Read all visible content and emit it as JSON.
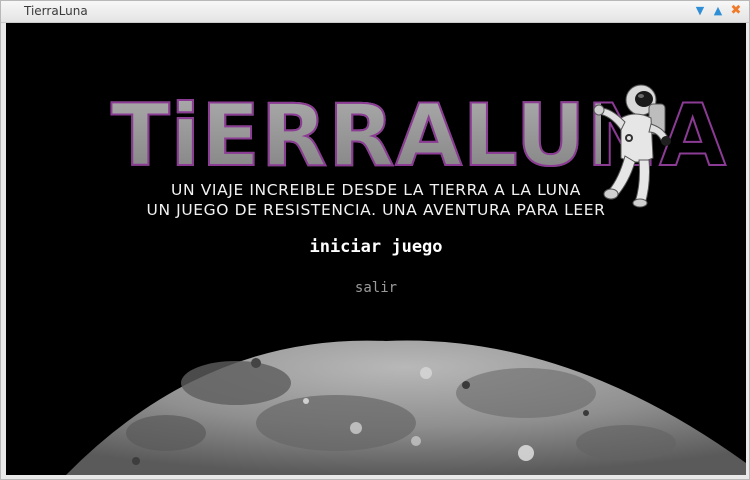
{
  "window": {
    "title": "TierraLuna",
    "controls": {
      "minimize": "▼",
      "maximize": "▲",
      "close": "✖"
    }
  },
  "game": {
    "logo_text": "TiERRALUNA",
    "subtitle_line1": "UN VIAJE INCREIBLE DESDE LA TIERRA A LA LUNA",
    "subtitle_line2": "UN JUEGO DE RESISTENCIA. UNA AVENTURA PARA LEER",
    "start_button": "iniciar juego",
    "quit_button": "salir"
  },
  "colors": {
    "background": "#000000",
    "logo_fill": "#8f8f8f",
    "logo_outline": "#8b3b94",
    "subtitle": "#f2f2f2",
    "start": "#ffffff",
    "quit": "#9a9a9a"
  },
  "icons": {
    "astronaut": "astronaut-icon",
    "moon": "moon-surface-image"
  }
}
